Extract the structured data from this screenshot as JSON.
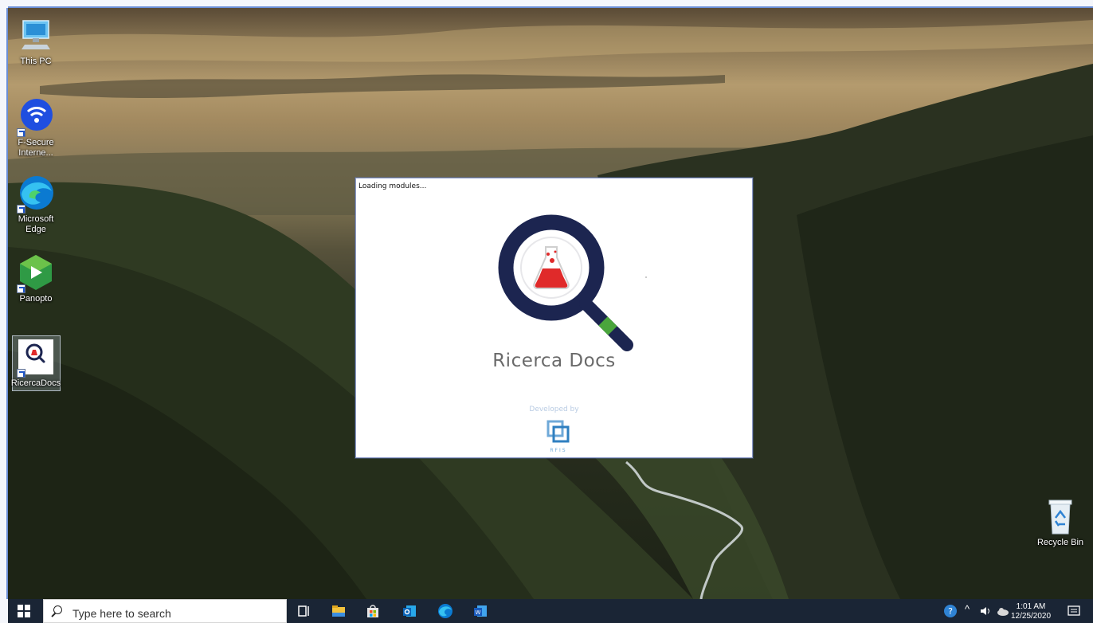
{
  "desktop": {
    "icons": [
      {
        "label": "This PC",
        "icon": "computer-icon"
      },
      {
        "label": "F-Secure Interne...",
        "icon": "fsecure-icon"
      },
      {
        "label": "Microsoft Edge",
        "icon": "edge-icon"
      },
      {
        "label": "Panopto",
        "icon": "panopto-icon"
      },
      {
        "label": "RicercaDocs",
        "icon": "ricercadocs-icon"
      },
      {
        "label": "Recycle Bin",
        "icon": "recycle-bin-icon"
      }
    ]
  },
  "splash": {
    "status": "Loading modules...",
    "app_name": "Ricerca Docs",
    "developed_by": "Developed by",
    "developer_logo_text": "RFIS",
    "colors": {
      "navy": "#1c2550",
      "flask_red": "#e02a2a",
      "accent_green": "#4aa53c"
    }
  },
  "taskbar": {
    "search_placeholder": "Type here to search",
    "pinned": [
      "task-view-icon",
      "file-explorer-icon",
      "store-icon",
      "outlook-icon",
      "edge-icon",
      "word-icon"
    ],
    "time": "1:01 AM",
    "date": "12/25/2020"
  }
}
